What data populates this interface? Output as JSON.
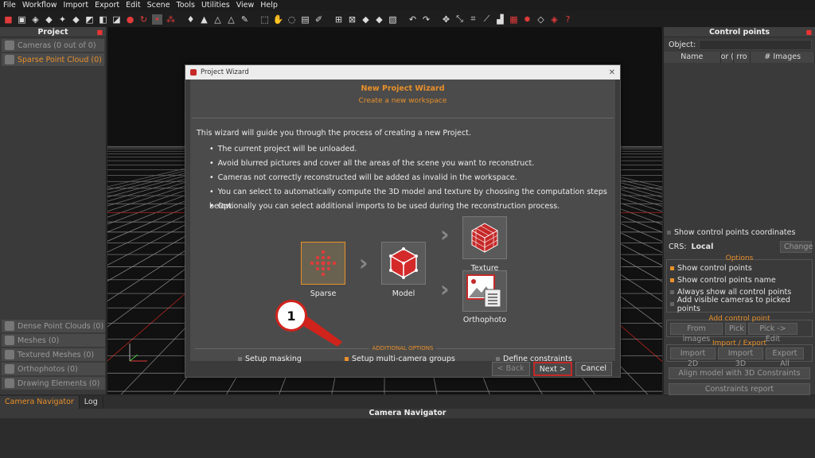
{
  "menu": [
    "File",
    "Workflow",
    "Import",
    "Export",
    "Edit",
    "Scene",
    "Tools",
    "Utilities",
    "View",
    "Help"
  ],
  "left_panel": {
    "title": "Project",
    "items_top": [
      {
        "label": "Cameras (0 out of 0)",
        "active": false
      },
      {
        "label": "Sparse Point Cloud (0)",
        "active": true
      }
    ],
    "items_bottom": [
      {
        "label": "Dense Point Clouds (0)"
      },
      {
        "label": "Meshes (0)"
      },
      {
        "label": "Textured Meshes (0)"
      },
      {
        "label": "Orthophotos (0)"
      },
      {
        "label": "Drawing Elements (0)"
      }
    ]
  },
  "right_panel": {
    "title": "Control points",
    "object_label": "Object:",
    "columns": [
      "Name",
      "or (",
      "rro",
      "# Images"
    ],
    "show_coords": "Show control points coordinates",
    "crs_label": "CRS:",
    "crs_value": "Local",
    "change_btn": "Change",
    "options_title": "Options",
    "options": [
      {
        "label": "Show control points",
        "on": true
      },
      {
        "label": "Show control points name",
        "on": true
      },
      {
        "label": "Always show all control points",
        "on": false
      },
      {
        "label": "Add visible cameras to picked points",
        "on": false
      }
    ],
    "add_title": "Add control point",
    "add_buttons": [
      "From images",
      "Pick",
      "Pick -> Edit"
    ],
    "import_title": "Import / Export",
    "import_buttons": [
      "Import 2D",
      "Import 3D",
      "Export All"
    ],
    "align_btn": "Align model with 3D Constraints",
    "report_btn": "Constraints report"
  },
  "bottom": {
    "tabs": [
      "Camera Navigator",
      "Log"
    ],
    "title": "Camera Navigator"
  },
  "dialog": {
    "window_title": "Project Wizard",
    "heading": "New Project Wizard",
    "subheading": "Create a new workspace",
    "intro": "This wizard will guide you through the process of creating a new Project.",
    "bullets": [
      "The current project will be unloaded.",
      "Avoid blurred pictures and cover all the areas of the scene you want to reconstruct.",
      "Cameras not correctly reconstructed will be added as invalid in the workspace.",
      "You can select to automatically compute the 3D model and texture by choosing the computation steps below.",
      "Optionally you can select additional imports to be used during the reconstruction process."
    ],
    "steps": {
      "sparse": "Sparse",
      "model": "Model",
      "texture": "Texture",
      "orthophoto": "Orthophoto"
    },
    "additional_title": "ADDITIONAL OPTIONS",
    "options": [
      {
        "label": "Setup masking",
        "on": false
      },
      {
        "label": "Setup multi-camera groups",
        "on": true
      },
      {
        "label": "Define constraints",
        "on": false
      }
    ],
    "back_btn": "< Back",
    "next_btn": "Next >",
    "cancel_btn": "Cancel"
  },
  "callout": "1",
  "colors": {
    "accent": "#e8902a",
    "highlight": "#d0231c",
    "grid_red": "#c8261e"
  }
}
